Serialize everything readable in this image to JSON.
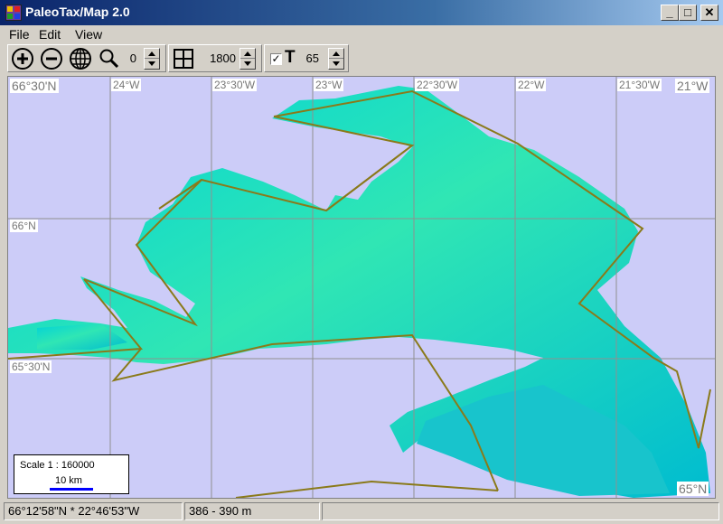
{
  "window": {
    "title": "PaleoTax/Map 2.0",
    "min_label": "_",
    "max_label": "□",
    "close_label": "✕"
  },
  "menu": [
    "File",
    "Edit",
    "View"
  ],
  "toolbar": {
    "zoom_value": "0",
    "grid_value": "1800",
    "labels_checked": true,
    "check_glyph": "✓",
    "labels_letter": "T",
    "labels_size": "65"
  },
  "map": {
    "grid_labels": {
      "top_left_corner": "66°30'N",
      "lon_24": "24°W",
      "lon_2330": "23°30'W",
      "lon_23": "23°W",
      "lon_2230": "22°30'W",
      "lon_22": "22°W",
      "lon_2130": "21°30'W",
      "top_right_corner": "21°W",
      "lat_66": "66°N",
      "lat_6530": "65°30'N",
      "bottom_right_corner": "65°N"
    },
    "scale_text": "Scale 1 : 160000",
    "scale_bar_label": "10 km",
    "colors": {
      "sea": "#ccccf8",
      "land_low": "#00c8d4",
      "land_high": "#60f0a0",
      "border_line": "#8a7a1a",
      "grid": "#909090",
      "scale_bar": "#0000ff"
    }
  },
  "status": {
    "coordinates": "66°12'58\"N * 22°46'53\"W",
    "elevation": "386 - 390 m",
    "extra": ""
  }
}
